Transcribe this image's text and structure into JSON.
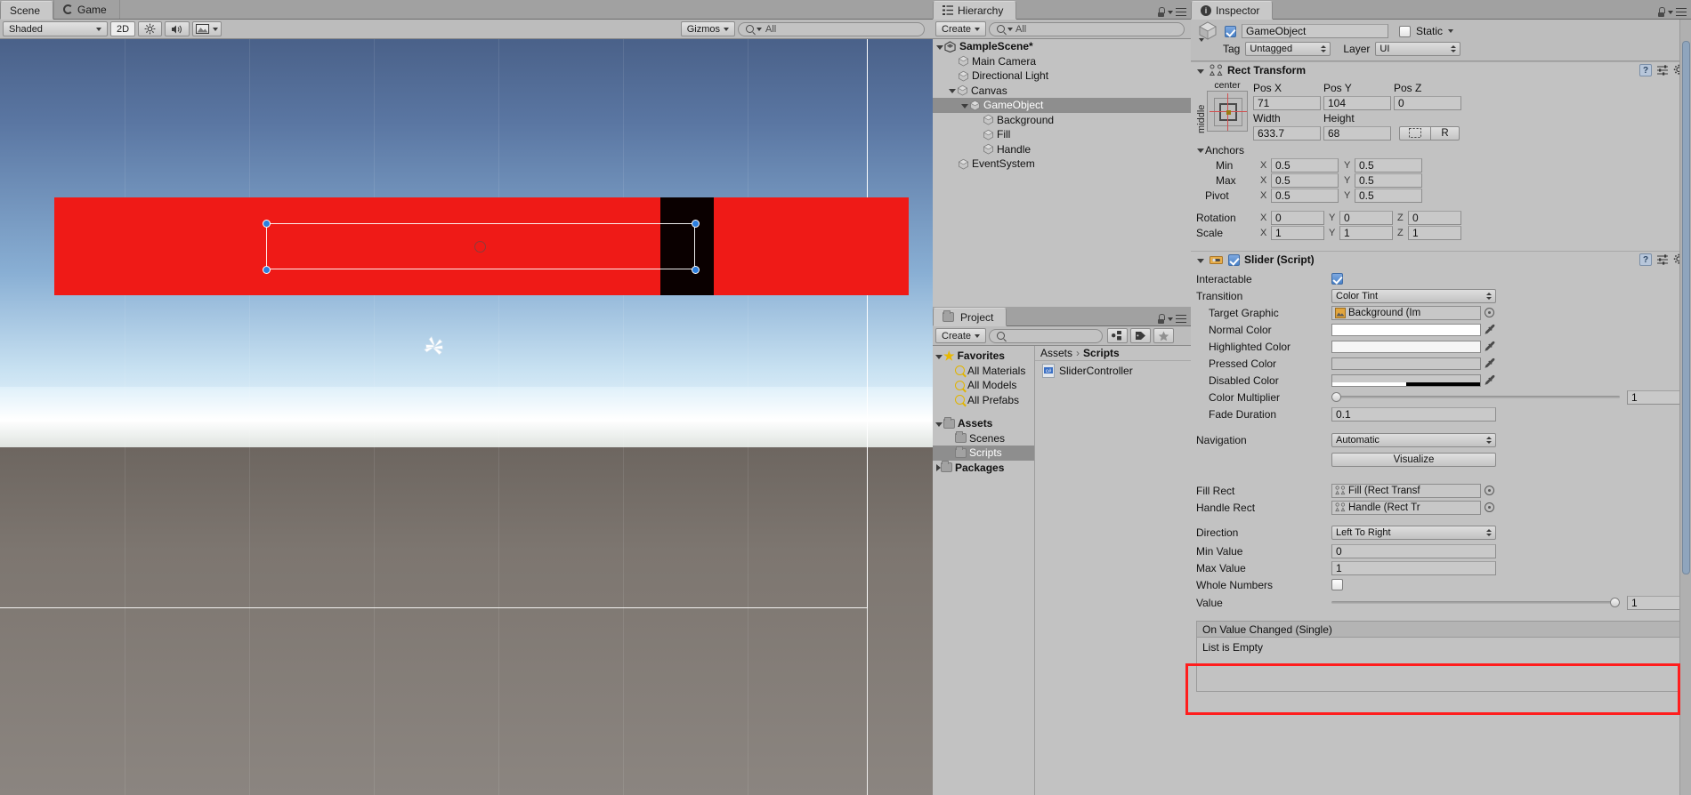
{
  "scene_view": {
    "tabs": [
      {
        "label": "Scene",
        "active": true,
        "icon": "scene-icon"
      },
      {
        "label": "Game",
        "active": false,
        "icon": "game-icon"
      }
    ],
    "toolbar": {
      "shading_mode": "Shaded",
      "mode_2d": "2D",
      "lighting_icon": "sun-icon",
      "audio_icon": "speaker-icon",
      "effects_icon": "image-icon",
      "gizmos_label": "Gizmos",
      "search_placeholder": "All",
      "search_value": ""
    },
    "gizmo_icon": "move-gizmo-icon",
    "selection": {
      "pivot_icon": "pivot-ring-icon",
      "handle_dots": 4
    }
  },
  "hierarchy": {
    "title": "Hierarchy",
    "create_label": "Create",
    "search_placeholder": "All",
    "search_value": "",
    "scene_name": "SampleScene*",
    "items": [
      {
        "label": "Main Camera",
        "depth": 1,
        "expandable": false,
        "expanded": false,
        "selected": false
      },
      {
        "label": "Directional Light",
        "depth": 1,
        "expandable": false,
        "expanded": false,
        "selected": false
      },
      {
        "label": "Canvas",
        "depth": 1,
        "expandable": true,
        "expanded": true,
        "selected": false
      },
      {
        "label": "GameObject",
        "depth": 2,
        "expandable": true,
        "expanded": true,
        "selected": true
      },
      {
        "label": "Background",
        "depth": 3,
        "expandable": false,
        "expanded": false,
        "selected": false
      },
      {
        "label": "Fill",
        "depth": 3,
        "expandable": false,
        "expanded": false,
        "selected": false
      },
      {
        "label": "Handle",
        "depth": 3,
        "expandable": false,
        "expanded": false,
        "selected": false
      },
      {
        "label": "EventSystem",
        "depth": 1,
        "expandable": false,
        "expanded": false,
        "selected": false
      }
    ]
  },
  "project": {
    "title": "Project",
    "create_label": "Create",
    "search_placeholder": "",
    "search_value": "",
    "toolbar_icons": [
      "filter-by-type-icon",
      "filter-by-label-icon",
      "favorite-star-icon"
    ],
    "tree": [
      {
        "label": "Favorites",
        "icon": "star-icon",
        "depth": 0,
        "expandable": true,
        "expanded": true,
        "bold": true,
        "selected": false
      },
      {
        "label": "All Materials",
        "icon": "search-icon",
        "depth": 1,
        "expandable": false,
        "expanded": false,
        "bold": false,
        "selected": false
      },
      {
        "label": "All Models",
        "icon": "search-icon",
        "depth": 1,
        "expandable": false,
        "expanded": false,
        "bold": false,
        "selected": false
      },
      {
        "label": "All Prefabs",
        "icon": "search-icon",
        "depth": 1,
        "expandable": false,
        "expanded": false,
        "bold": false,
        "selected": false
      },
      {
        "label": "",
        "icon": "spacer",
        "depth": 0,
        "expandable": false,
        "expanded": false,
        "bold": false,
        "selected": false
      },
      {
        "label": "Assets",
        "icon": "folder-icon",
        "depth": 0,
        "expandable": true,
        "expanded": true,
        "bold": true,
        "selected": false
      },
      {
        "label": "Scenes",
        "icon": "folder-icon",
        "depth": 1,
        "expandable": false,
        "expanded": false,
        "bold": false,
        "selected": false
      },
      {
        "label": "Scripts",
        "icon": "folder-icon",
        "depth": 1,
        "expandable": false,
        "expanded": false,
        "bold": false,
        "selected": true
      },
      {
        "label": "Packages",
        "icon": "folder-icon",
        "depth": 0,
        "expandable": true,
        "expanded": false,
        "bold": true,
        "selected": false
      }
    ],
    "breadcrumb": [
      "Assets",
      "Scripts"
    ],
    "assets": [
      {
        "label": "SliderController",
        "icon": "csharp-script-icon"
      }
    ]
  },
  "inspector": {
    "title": "Inspector",
    "object_name": "GameObject",
    "object_enabled": true,
    "static_label": "Static",
    "static_checked": false,
    "tag_label": "Tag",
    "tag_value": "Untagged",
    "layer_label": "Layer",
    "layer_value": "UI",
    "rect_transform": {
      "title": "Rect Transform",
      "anchor_preset_top": "center",
      "anchor_preset_side": "middle",
      "pos_labels": [
        "Pos X",
        "Pos Y",
        "Pos Z"
      ],
      "pos_values": [
        "71",
        "104",
        "0"
      ],
      "size_labels": [
        "Width",
        "Height"
      ],
      "size_values": [
        "633.7",
        "68"
      ],
      "blueprint_button": "blueprint-mode-icon",
      "raw_button": "R",
      "anchors_label": "Anchors",
      "min_label": "Min",
      "min_x": "0.5",
      "min_y": "0.5",
      "max_label": "Max",
      "max_x": "0.5",
      "max_y": "0.5",
      "pivot_label": "Pivot",
      "pivot_x": "0.5",
      "pivot_y": "0.5",
      "rotation_label": "Rotation",
      "rotation": [
        "0",
        "0",
        "0"
      ],
      "scale_label": "Scale",
      "scale": [
        "1",
        "1",
        "1"
      ]
    },
    "slider_component": {
      "title": "Slider (Script)",
      "enabled": true,
      "interactable_label": "Interactable",
      "interactable_checked": true,
      "transition_label": "Transition",
      "transition_value": "Color Tint",
      "target_graphic_label": "Target Graphic",
      "target_graphic_value": "Background (Im",
      "normal_color_label": "Normal Color",
      "normal_color": "#FFFFFF",
      "highlighted_color_label": "Highlighted Color",
      "highlighted_color": "#F5F5F5",
      "pressed_color_label": "Pressed Color",
      "pressed_color": "#C8C8C8",
      "disabled_color_label": "Disabled Color",
      "disabled_color": "#C8C8C8",
      "color_multiplier_label": "Color Multiplier",
      "color_multiplier_value": "1",
      "color_multiplier_pct": 0,
      "fade_duration_label": "Fade Duration",
      "fade_duration_value": "0.1",
      "navigation_label": "Navigation",
      "navigation_value": "Automatic",
      "visualize_label": "Visualize",
      "fill_rect_label": "Fill Rect",
      "fill_rect_value": "Fill (Rect Transf",
      "handle_rect_label": "Handle Rect",
      "handle_rect_value": "Handle (Rect Tr",
      "direction_label": "Direction",
      "direction_value": "Left To Right",
      "min_value_label": "Min Value",
      "min_value": "0",
      "max_value_label": "Max Value",
      "max_value": "1",
      "whole_numbers_label": "Whole Numbers",
      "whole_numbers_checked": false,
      "value_label": "Value",
      "value": "1",
      "value_pct": 100,
      "on_value_changed_label": "On Value Changed (Single)",
      "list_empty_label": "List is Empty"
    },
    "highlight_color": "#FF1D1D"
  }
}
